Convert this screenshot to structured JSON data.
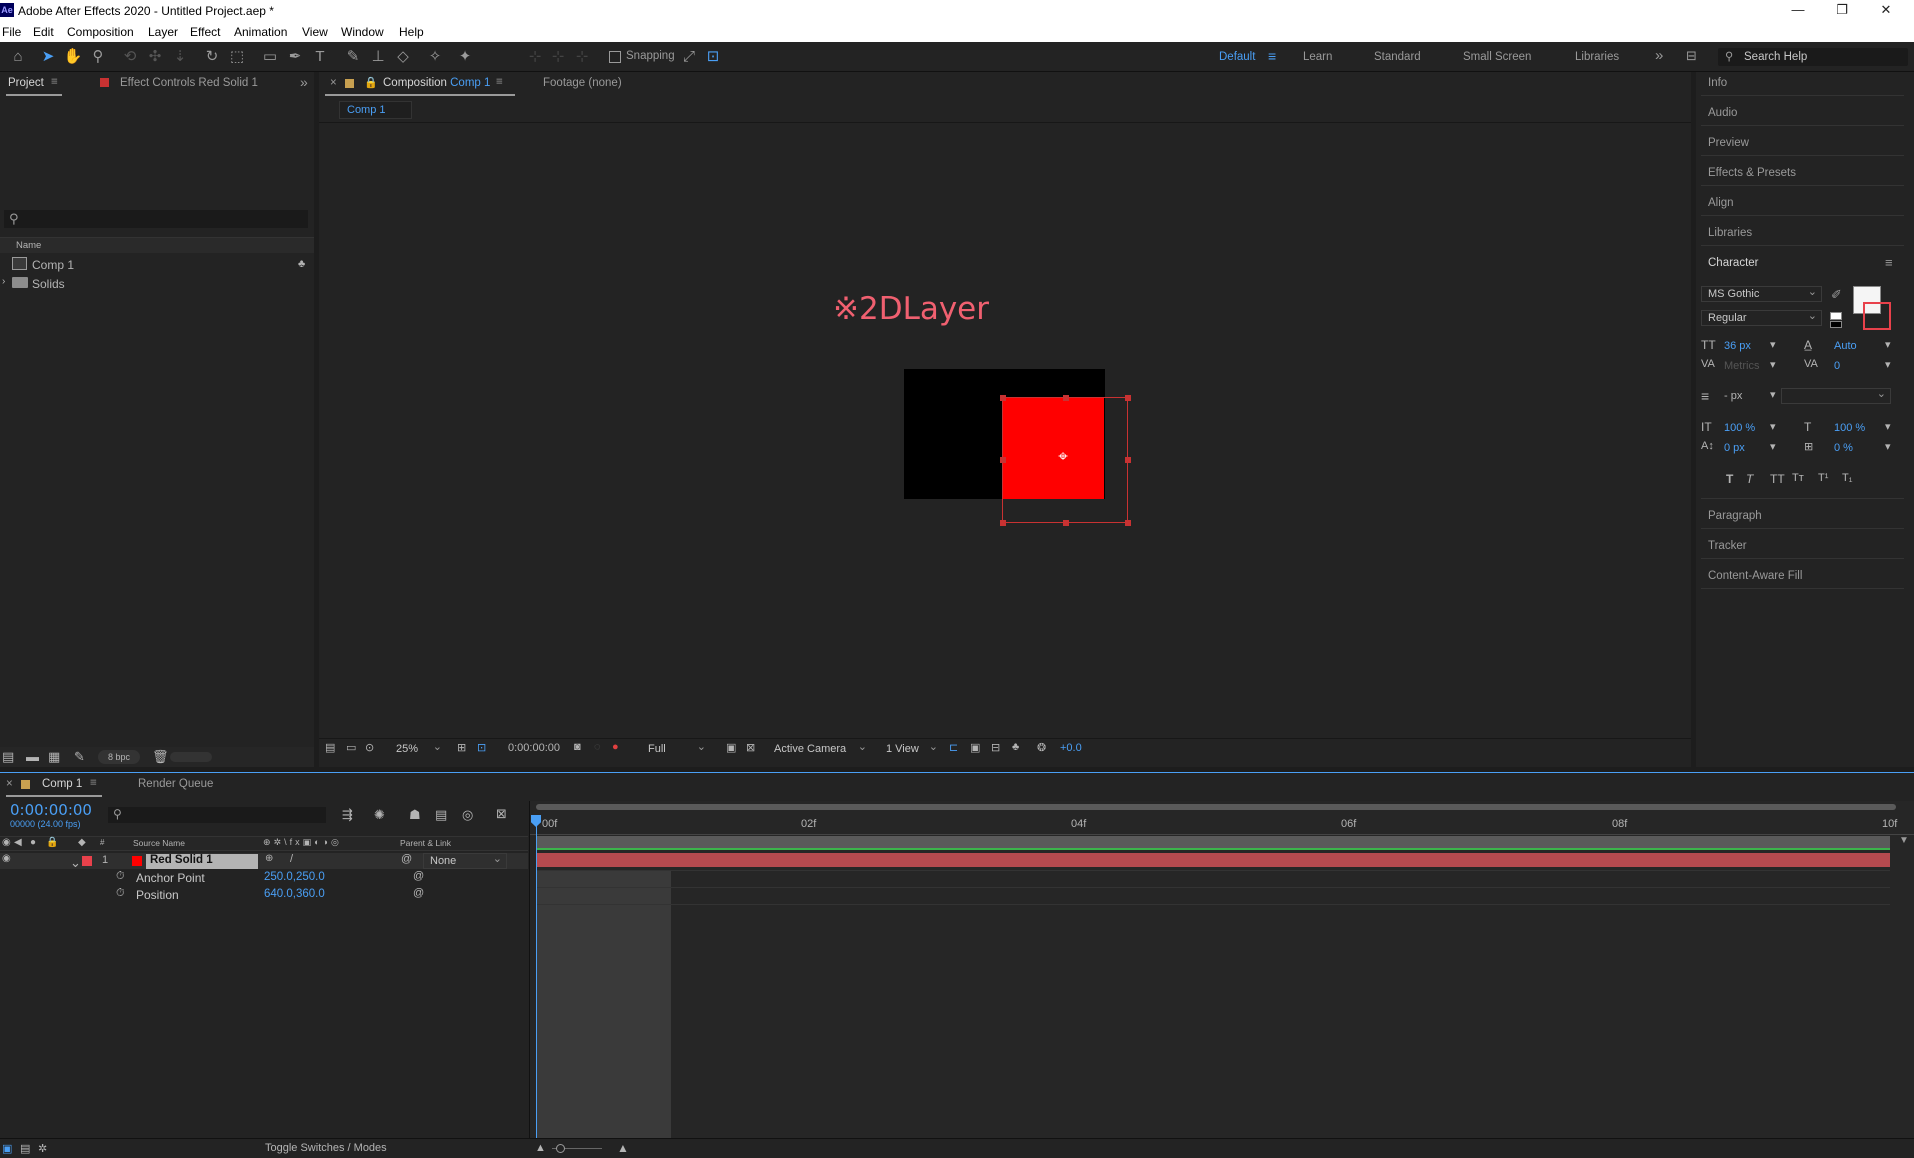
{
  "window": {
    "title": "Adobe After Effects 2020 - Untitled Project.aep *",
    "logo": "Ae",
    "controls": [
      "—",
      "❐",
      "✕"
    ]
  },
  "menu": [
    "File",
    "Edit",
    "Composition",
    "Layer",
    "Effect",
    "Animation",
    "View",
    "Window",
    "Help"
  ],
  "toolbar": {
    "snapping_label": "Snapping",
    "workspaces": [
      "Default",
      "Learn",
      "Standard",
      "Small Screen",
      "Libraries"
    ],
    "active_workspace": "Default",
    "search_placeholder": "Search Help"
  },
  "project_panel": {
    "tab_project": "Project",
    "tab_effect_controls": "Effect Controls",
    "effect_controls_target": "Red Solid 1",
    "column_name": "Name",
    "items": [
      {
        "name": "Comp 1",
        "type": "composition"
      },
      {
        "name": "Solids",
        "type": "folder"
      }
    ],
    "bpc": "8 bpc"
  },
  "comp_panel": {
    "tab_label": "Composition",
    "tab_target": "Comp 1",
    "footage_label": "Footage",
    "footage_value": "(none)",
    "breadcrumb": "Comp 1",
    "overlay_text": "※2DLayer",
    "zoom": "25%",
    "timecode": "0:00:00:00",
    "resolution": "Full",
    "camera": "Active Camera",
    "views": "1 View",
    "exposure": "+0.0"
  },
  "right_panels": {
    "items": [
      "Info",
      "Audio",
      "Preview",
      "Effects & Presets",
      "Align",
      "Libraries"
    ],
    "character": {
      "title": "Character",
      "font": "MS Gothic",
      "style": "Regular",
      "size": "36 px",
      "leading": "Auto",
      "kerning": "Metrics",
      "tracking": "0",
      "stroke": "- px",
      "vscale": "100 %",
      "hscale": "100 %",
      "baseline": "0 px",
      "tsume": "0 %"
    },
    "items_after": [
      "Paragraph",
      "Tracker",
      "Content-Aware Fill"
    ]
  },
  "timeline": {
    "tab_comp": "Comp 1",
    "tab_render": "Render Queue",
    "timecode": "0:00:00:00",
    "frame_info": "00000 (24.00 fps)",
    "columns": {
      "source_name": "Source Name",
      "parent_link": "Parent & Link"
    },
    "ruler": [
      "00f",
      "02f",
      "04f",
      "06f",
      "08f",
      "10f"
    ],
    "layer": {
      "number": "1",
      "name": "Red Solid 1",
      "parent": "None"
    },
    "properties": [
      {
        "name": "Anchor Point",
        "value": "250.0,250.0"
      },
      {
        "name": "Position",
        "value": "640.0,360.0"
      }
    ],
    "toggle_label": "Toggle Switches / Modes"
  },
  "colors": {
    "accent": "#4a9ff5",
    "red_solid": "#ff0000",
    "label_red": "#e8414b",
    "layer_bar": "#b54a4f",
    "overlay_text": "#f06070"
  }
}
